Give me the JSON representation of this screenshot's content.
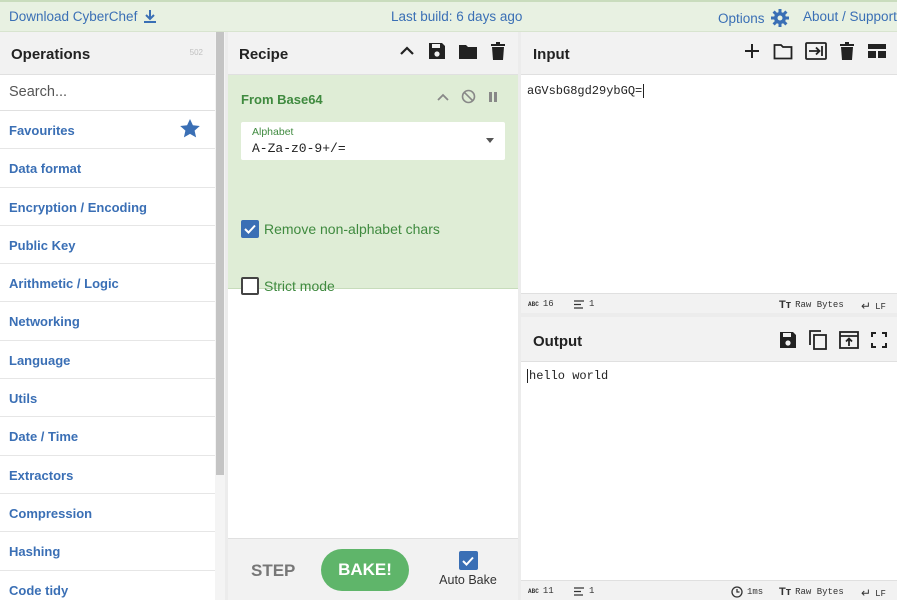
{
  "banner": {
    "download": "Download CyberChef",
    "last_build": "Last build: 6 days ago",
    "options": "Options",
    "about": "About / Support"
  },
  "operations": {
    "title": "Operations",
    "count": "502",
    "search_placeholder": "Search...",
    "categories": [
      "Favourites",
      "Data format",
      "Encryption / Encoding",
      "Public Key",
      "Arithmetic / Logic",
      "Networking",
      "Language",
      "Utils",
      "Date / Time",
      "Extractors",
      "Compression",
      "Hashing",
      "Code tidy"
    ]
  },
  "recipe": {
    "title": "Recipe",
    "operation": {
      "name": "From Base64",
      "alphabet_label": "Alphabet",
      "alphabet_value": "A-Za-z0-9+/=",
      "remove_label": "Remove non-alphabet chars",
      "remove_checked": true,
      "strict_label": "Strict mode",
      "strict_checked": false
    },
    "step_label": "STEP",
    "bake_label": "BAKE!",
    "autobake_label": "Auto Bake",
    "autobake_checked": true
  },
  "input": {
    "title": "Input",
    "text": "aGVsbG8gd29ybGQ=",
    "length": "16",
    "lines": "1",
    "encoding": "Raw Bytes",
    "eol": "LF"
  },
  "output": {
    "title": "Output",
    "text": "hello world",
    "length": "11",
    "lines": "1",
    "time": "1ms",
    "encoding": "Raw Bytes",
    "eol": "LF"
  },
  "colors": {
    "link_blue": "#3a6fb5",
    "op_green": "#3f8a3f",
    "card_bg": "#dfedd6",
    "bake_green": "#5fb56a"
  }
}
